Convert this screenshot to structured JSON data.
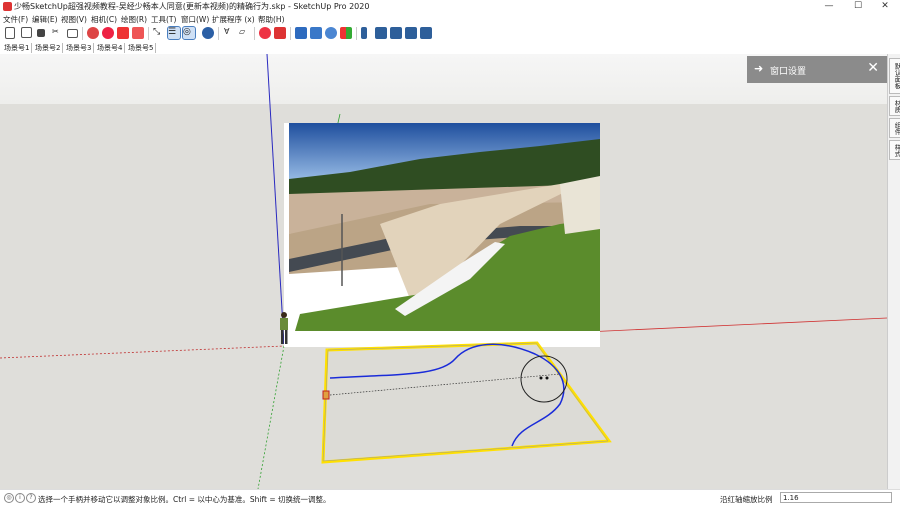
{
  "window": {
    "title": "少畅SketchUp超强视频教程-吴经少畅本人同意(更新本视频)的精确行为.skp - SketchUp Pro 2020",
    "controls": {
      "minimize": "—",
      "maximize": "☐",
      "close": "✕"
    }
  },
  "menu": [
    "文件(F)",
    "编辑(E)",
    "视图(V)",
    "相机(C)",
    "绘图(R)",
    "工具(T)",
    "窗口(W)",
    "扩展程序 (x)",
    "帮助(H)"
  ],
  "toolbar": {
    "icons": [
      "new-icon",
      "open-icon",
      "save-icon",
      "cut-icon",
      "print-icon",
      "select-icon",
      "eraser-icon",
      "paint-icon",
      "rectangle-icon",
      "push-pull-icon",
      "move-icon",
      "scale-icon",
      "rotate-icon",
      "orbit-icon",
      "pan-icon",
      "tape-icon",
      "axes-icon",
      "section-icon",
      "warehouse-icon",
      "component-icon",
      "style-icon",
      "xray-icon",
      "shadow-icon",
      "layer-icon",
      "iso-view-icon",
      "top-view-icon",
      "front-view-icon",
      "right-view-icon",
      "zoom-extents-icon"
    ]
  },
  "scenes": [
    "场景号1",
    "场景号2",
    "场景号3",
    "场景号4",
    "场景号5"
  ],
  "tray": {
    "title": "窗口设置",
    "arrow": "➜",
    "close": "✕"
  },
  "sidebar_tabs": [
    "默认面板",
    "材质",
    "组件",
    "样式"
  ],
  "statusbar": {
    "hint": "选择一个手柄并移动它以调整对象比例。Ctrl = 以中心为基准。Shift = 切换统一调整。",
    "measure_label": "沿红轴缩放比例",
    "measure_value": "1.16",
    "icons": [
      "geo-location-icon",
      "credits-icon",
      "help-icon"
    ],
    "icon_glyphs": [
      "◎",
      "i",
      "?"
    ]
  },
  "colors": {
    "viewport_bg": "#e0dfdb",
    "sky": "#f4f4f4",
    "selection": "#ffe000",
    "curve": "#1a2bd9",
    "red_axis": "#d03030",
    "green_axis": "#30a030",
    "blue_axis": "#2020c0"
  }
}
